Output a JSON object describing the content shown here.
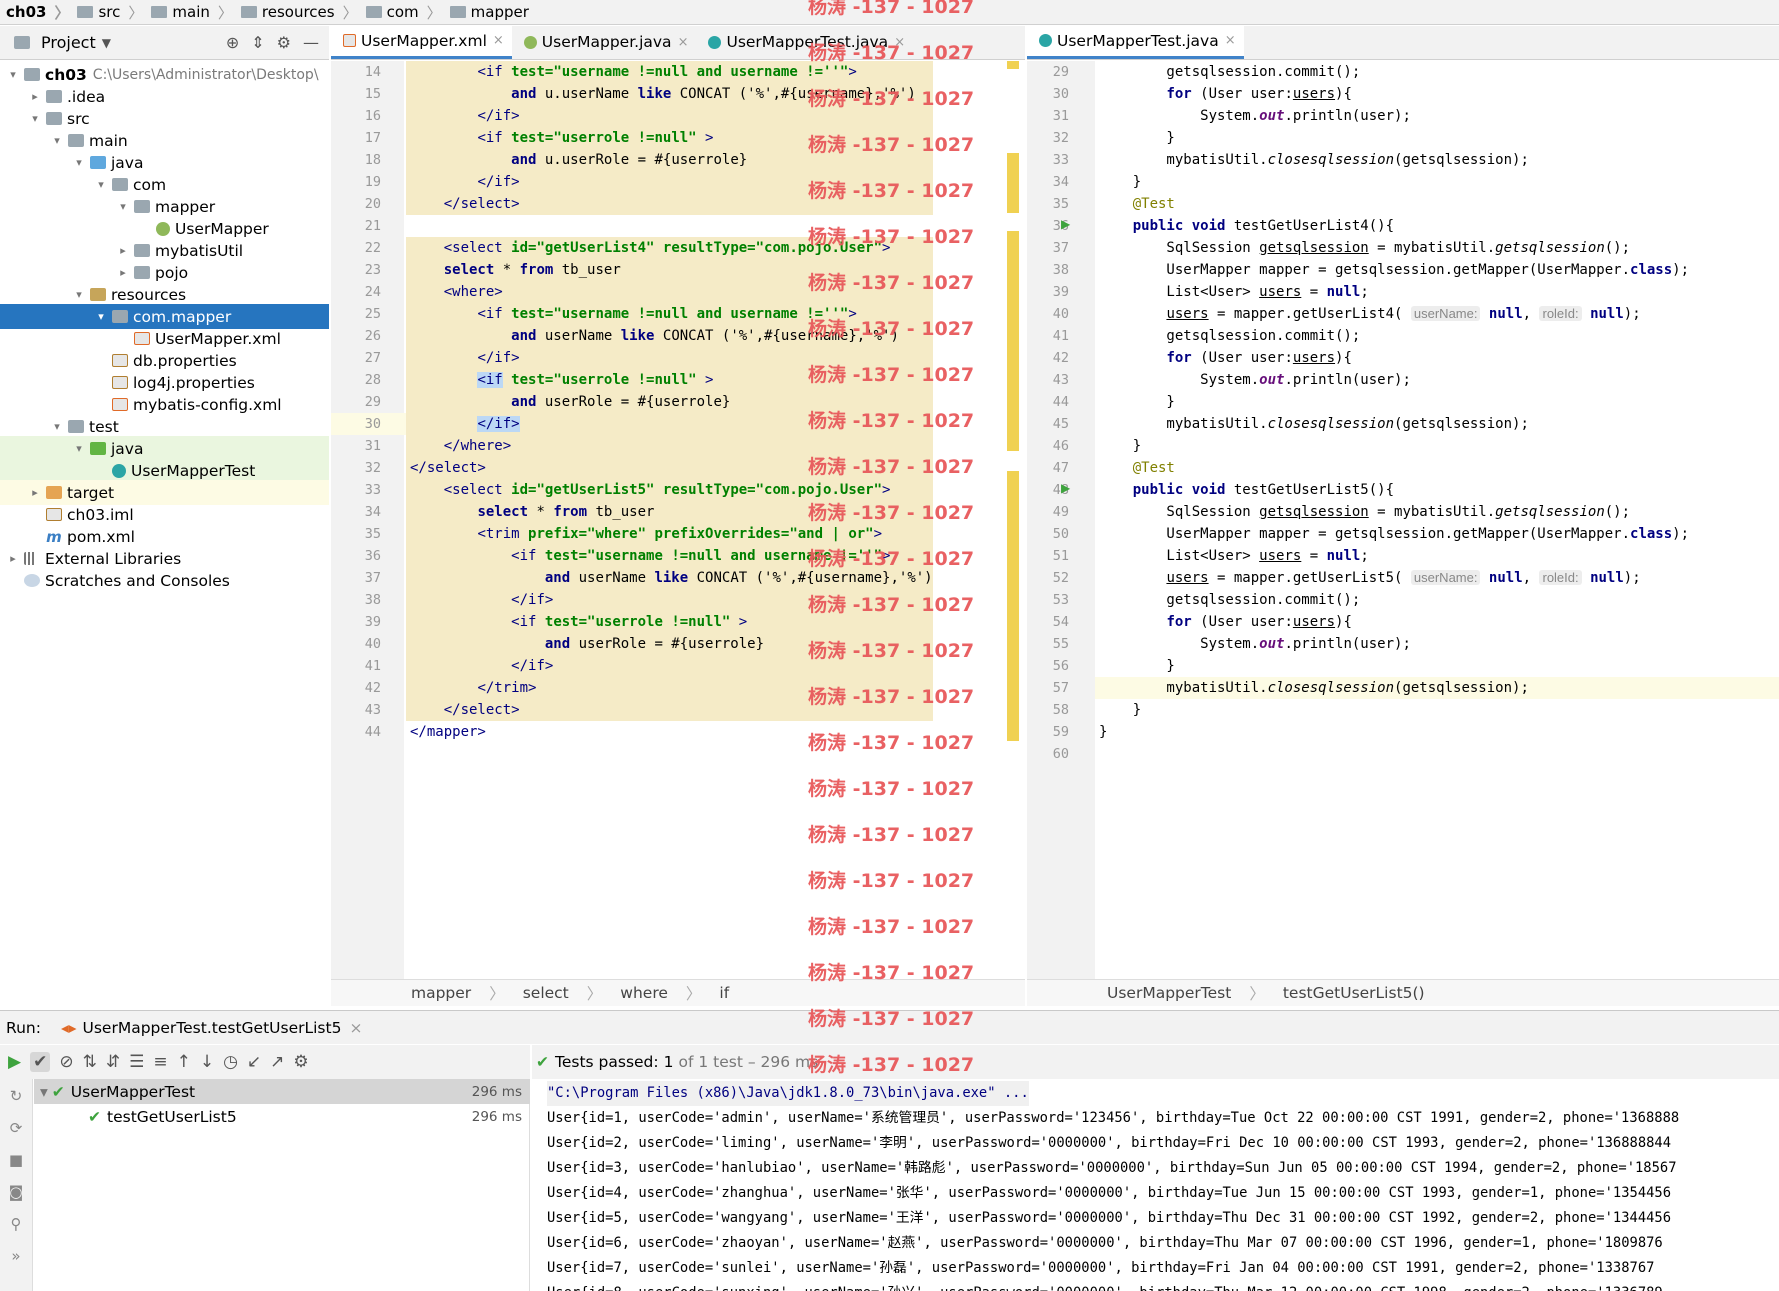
{
  "breadcrumb": [
    "ch03",
    "src",
    "main",
    "resources",
    "com",
    "mapper"
  ],
  "project_panel": {
    "title": "Project",
    "tree": [
      {
        "label": "ch03",
        "hint": "C:\\Users\\Administrator\\Desktop\\",
        "level": 0,
        "icon": "folder",
        "arrow": "down"
      },
      {
        "label": ".idea",
        "level": 1,
        "icon": "folder",
        "arrow": "right"
      },
      {
        "label": "src",
        "level": 1,
        "icon": "folder",
        "arrow": "down"
      },
      {
        "label": "main",
        "level": 2,
        "icon": "folder",
        "arrow": "down"
      },
      {
        "label": "java",
        "level": 3,
        "icon": "blue",
        "arrow": "down"
      },
      {
        "label": "com",
        "level": 4,
        "icon": "folder",
        "arrow": "down"
      },
      {
        "label": "mapper",
        "level": 5,
        "icon": "folder",
        "arrow": "down"
      },
      {
        "label": "UserMapper",
        "level": 6,
        "icon": "circleI",
        "arrow": ""
      },
      {
        "label": "mybatisUtil",
        "level": 5,
        "icon": "folder",
        "arrow": "right"
      },
      {
        "label": "pojo",
        "level": 5,
        "icon": "folder",
        "arrow": "right"
      },
      {
        "label": "resources",
        "level": 3,
        "icon": "res",
        "arrow": "down"
      },
      {
        "label": "com.mapper",
        "level": 4,
        "icon": "folder",
        "arrow": "down",
        "selected": true
      },
      {
        "label": "UserMapper.xml",
        "level": 5,
        "icon": "xml",
        "arrow": ""
      },
      {
        "label": "db.properties",
        "level": 4,
        "icon": "prop",
        "arrow": ""
      },
      {
        "label": "log4j.properties",
        "level": 4,
        "icon": "prop",
        "arrow": ""
      },
      {
        "label": "mybatis-config.xml",
        "level": 4,
        "icon": "xml",
        "arrow": ""
      },
      {
        "label": "test",
        "level": 2,
        "icon": "folder",
        "arrow": "down"
      },
      {
        "label": "java",
        "level": 3,
        "icon": "green",
        "arrow": "down",
        "test": true
      },
      {
        "label": "UserMapperTest",
        "level": 4,
        "icon": "circle",
        "arrow": "",
        "test": true
      },
      {
        "label": "target",
        "level": 1,
        "icon": "orange",
        "arrow": "right",
        "target": true
      },
      {
        "label": "ch03.iml",
        "level": 1,
        "icon": "prop",
        "arrow": ""
      },
      {
        "label": "pom.xml",
        "level": 1,
        "icon": "m",
        "arrow": ""
      },
      {
        "label": "External Libraries",
        "level": 0,
        "icon": "lib",
        "arrow": "right"
      },
      {
        "label": "Scratches and Consoles",
        "level": 0,
        "icon": "scratch",
        "arrow": ""
      }
    ]
  },
  "tabs_left": [
    {
      "label": "UserMapper.xml",
      "active": true
    },
    {
      "label": "UserMapper.java",
      "active": false
    },
    {
      "label": "UserMapperTest.java",
      "active": false
    }
  ],
  "tabs_right": [
    {
      "label": "UserMapperTest.java",
      "active": true
    }
  ],
  "left_editor": {
    "lines": [
      {
        "n": "14",
        "html": "        <span class=\"tagc\">&lt;if</span> <span class=\"str\">test=\"username !=null and username !=''\"</span><span class=\"tagc\">&gt;</span>"
      },
      {
        "n": "15",
        "html": "            <span class=\"kw\">and</span> u.userName <span class=\"kw\">like</span> CONCAT ('%',#{username},'%')"
      },
      {
        "n": "16",
        "html": "        <span class=\"tagc\">&lt;/if&gt;</span>"
      },
      {
        "n": "17",
        "html": "        <span class=\"tagc\">&lt;if</span> <span class=\"str\">test=\"userrole !=null\"</span> <span class=\"tagc\">&gt;</span>"
      },
      {
        "n": "18",
        "html": "            <span class=\"kw\">and</span> u.userRole = #{userrole}"
      },
      {
        "n": "19",
        "html": "        <span class=\"tagc\">&lt;/if&gt;</span>"
      },
      {
        "n": "20",
        "html": "    <span class=\"tagc\">&lt;/select&gt;</span>"
      },
      {
        "n": "21",
        "html": ""
      },
      {
        "n": "22",
        "html": "    <span class=\"tagc\">&lt;select</span> <span class=\"str\">id=\"getUserList4\" resultType=\"com.pojo.User\"</span><span class=\"tagc\">&gt;</span>"
      },
      {
        "n": "23",
        "html": "    <span class=\"kw\">select</span> * <span class=\"kw\">from</span> tb_user"
      },
      {
        "n": "24",
        "html": "    <span class=\"tagc\">&lt;where&gt;</span>"
      },
      {
        "n": "25",
        "html": "        <span class=\"tagc\">&lt;if</span> <span class=\"str\">test=\"username !=null and username !=''\"</span><span class=\"tagc\">&gt;</span>"
      },
      {
        "n": "26",
        "html": "            <span class=\"kw\">and</span> userName <span class=\"kw\">like</span> CONCAT ('%',#{username},'%')"
      },
      {
        "n": "27",
        "html": "        <span class=\"tagc\">&lt;/if&gt;</span>"
      },
      {
        "n": "28",
        "html": "        <span class=\"tagc selbrace\">&lt;if</span> <span class=\"str\">test=\"userrole !=null\"</span> <span class=\"tagc\">&gt;</span>"
      },
      {
        "n": "29",
        "html": "            <span class=\"kw\">and</span> userRole = #{userrole}"
      },
      {
        "n": "30",
        "html": "        <span class=\"tagc selbrace\">&lt;/if&gt;</span>"
      },
      {
        "n": "31",
        "html": "    <span class=\"tagc\">&lt;/where&gt;</span>"
      },
      {
        "n": "32",
        "html": "<span class=\"tagc\">&lt;/select&gt;</span>"
      },
      {
        "n": "33",
        "html": "    <span class=\"tagc\">&lt;select</span> <span class=\"str\">id=\"getUserList5\" resultType=\"com.pojo.User\"</span><span class=\"tagc\">&gt;</span>"
      },
      {
        "n": "34",
        "html": "        <span class=\"kw\">select</span> * <span class=\"kw\">from</span> tb_user"
      },
      {
        "n": "35",
        "html": "        <span class=\"tagc\">&lt;trim</span> <span class=\"str\">prefix=\"where\" prefixOverrides=\"and | or\"</span><span class=\"tagc\">&gt;</span>"
      },
      {
        "n": "36",
        "html": "            <span class=\"tagc\">&lt;if</span> <span class=\"str\">test=\"username !=null and username !=''\"</span><span class=\"tagc\">&gt;</span>"
      },
      {
        "n": "37",
        "html": "                <span class=\"kw\">and</span> userName <span class=\"kw\">like</span> CONCAT ('%',#{username},'%')"
      },
      {
        "n": "38",
        "html": "            <span class=\"tagc\">&lt;/if&gt;</span>"
      },
      {
        "n": "39",
        "html": "            <span class=\"tagc\">&lt;if</span> <span class=\"str\">test=\"userrole !=null\"</span> <span class=\"tagc\">&gt;</span>"
      },
      {
        "n": "40",
        "html": "                <span class=\"kw\">and</span> userRole = #{userrole}"
      },
      {
        "n": "41",
        "html": "            <span class=\"tagc\">&lt;/if&gt;</span>"
      },
      {
        "n": "42",
        "html": "        <span class=\"tagc\">&lt;/trim&gt;</span>"
      },
      {
        "n": "43",
        "html": "    <span class=\"tagc\">&lt;/select&gt;</span>"
      },
      {
        "n": "44",
        "html": "<span class=\"tagc\">&lt;/mapper&gt;</span>"
      }
    ],
    "breadcrumb": [
      "mapper",
      "select",
      "where",
      "if"
    ]
  },
  "right_editor": {
    "lines": [
      {
        "n": "29",
        "html": "        getsqlsession.commit();"
      },
      {
        "n": "30",
        "html": "        <span class=\"kw\">for</span> (User user:<span class=\"ul\">users</span>){"
      },
      {
        "n": "31",
        "html": "            System.<span class=\"stf\">out</span>.println(user);"
      },
      {
        "n": "32",
        "html": "        }"
      },
      {
        "n": "33",
        "html": "        mybatisUtil.<span class=\"itf\">closesqlsession</span>(getsqlsession);"
      },
      {
        "n": "34",
        "html": "    }"
      },
      {
        "n": "35",
        "html": "    <span class=\"ann\">@Test</span>"
      },
      {
        "n": "36",
        "html": "    <span class=\"kw\">public void</span> testGetUserList4(){"
      },
      {
        "n": "37",
        "html": "        SqlSession <span class=\"ul\">getsqlsession</span> = mybatisUtil.<span class=\"itf\">getsqlsession</span>();"
      },
      {
        "n": "38",
        "html": "        UserMapper mapper = getsqlsession.getMapper(UserMapper.<span class=\"kw\">class</span>);"
      },
      {
        "n": "39",
        "html": "        List&lt;User&gt; <span class=\"ul\">users</span> = <span class=\"kw\">null</span>;"
      },
      {
        "n": "40",
        "html": "        <span class=\"ul\">users</span> = mapper.getUserList4( <span class=\"hintbox\">userName:</span> <span class=\"kw\">null</span>, <span class=\"hintbox\">roleId:</span> <span class=\"kw\">null</span>);"
      },
      {
        "n": "41",
        "html": "        getsqlsession.commit();"
      },
      {
        "n": "42",
        "html": "        <span class=\"kw\">for</span> (User user:<span class=\"ul\">users</span>){"
      },
      {
        "n": "43",
        "html": "            System.<span class=\"stf\">out</span>.println(user);"
      },
      {
        "n": "44",
        "html": "        }"
      },
      {
        "n": "45",
        "html": "        mybatisUtil.<span class=\"itf\">closesqlsession</span>(getsqlsession);"
      },
      {
        "n": "46",
        "html": "    }"
      },
      {
        "n": "47",
        "html": "    <span class=\"ann\">@Test</span>"
      },
      {
        "n": "48",
        "html": "    <span class=\"kw\">public void</span> testGetUserList5(){"
      },
      {
        "n": "49",
        "html": "        SqlSession <span class=\"ul\">getsqlsession</span> = mybatisUtil.<span class=\"itf\">getsqlsession</span>();"
      },
      {
        "n": "50",
        "html": "        UserMapper mapper = getsqlsession.getMapper(UserMapper.<span class=\"kw\">class</span>);"
      },
      {
        "n": "51",
        "html": "        List&lt;User&gt; <span class=\"ul\">users</span> = <span class=\"kw\">null</span>;"
      },
      {
        "n": "52",
        "html": "        <span class=\"ul\">users</span> = mapper.getUserList5( <span class=\"hintbox\">userName:</span> <span class=\"kw\">null</span>, <span class=\"hintbox\">roleId:</span> <span class=\"kw\">null</span>);"
      },
      {
        "n": "53",
        "html": "        getsqlsession.commit();"
      },
      {
        "n": "54",
        "html": "        <span class=\"kw\">for</span> (User user:<span class=\"ul\">users</span>){"
      },
      {
        "n": "55",
        "html": "            System.<span class=\"stf\">out</span>.println(user);"
      },
      {
        "n": "56",
        "html": "        }"
      },
      {
        "n": "57",
        "html": "        mybatisUtil.<span class=\"itf\">closesqlsession</span>(getsqlsession);"
      },
      {
        "n": "58",
        "html": "    }"
      },
      {
        "n": "59",
        "html": "}"
      },
      {
        "n": "60",
        "html": ""
      }
    ],
    "breadcrumb": [
      "UserMapperTest",
      "testGetUserList5()"
    ]
  },
  "run": {
    "label": "Run:",
    "tab": "UserMapperTest.testGetUserList5",
    "status_prefix": "Tests passed:",
    "status_count": "1",
    "status_rest": "of 1 test – 296 ms",
    "tests": [
      {
        "name": "UserMapperTest",
        "time": "296 ms"
      },
      {
        "name": "testGetUserList5",
        "time": "296 ms"
      }
    ],
    "console": [
      "\"C:\\Program Files (x86)\\Java\\jdk1.8.0_73\\bin\\java.exe\" ...",
      "User{id=1, userCode='admin', userName='系统管理员', userPassword='123456', birthday=Tue Oct 22 00:00:00 CST 1991, gender=2, phone='1368888",
      "User{id=2, userCode='liming', userName='李明', userPassword='0000000', birthday=Fri Dec 10 00:00:00 CST 1993, gender=2, phone='136888844",
      "User{id=3, userCode='hanlubiao', userName='韩路彪', userPassword='0000000', birthday=Sun Jun 05 00:00:00 CST 1994, gender=2, phone='18567",
      "User{id=4, userCode='zhanghua', userName='张华', userPassword='0000000', birthday=Tue Jun 15 00:00:00 CST 1993, gender=1, phone='1354456",
      "User{id=5, userCode='wangyang', userName='王洋', userPassword='0000000', birthday=Thu Dec 31 00:00:00 CST 1992, gender=2, phone='1344456",
      "User{id=6, userCode='zhaoyan', userName='赵燕', userPassword='0000000', birthday=Thu Mar 07 00:00:00 CST 1996, gender=1, phone='1809876",
      "User{id=7, userCode='sunlei', userName='孙磊', userPassword='0000000', birthday=Fri Jan 04 00:00:00 CST 1991, gender=2, phone='1338767",
      "User{id=8, userCode='sunxing', userName='孙兴', userPassword='0000000', birthday=Thu Mar 12 00:00:00 CST 1998, gender=2, phone='1336789"
    ]
  },
  "watermark": "杨涛 -137 - 1027"
}
